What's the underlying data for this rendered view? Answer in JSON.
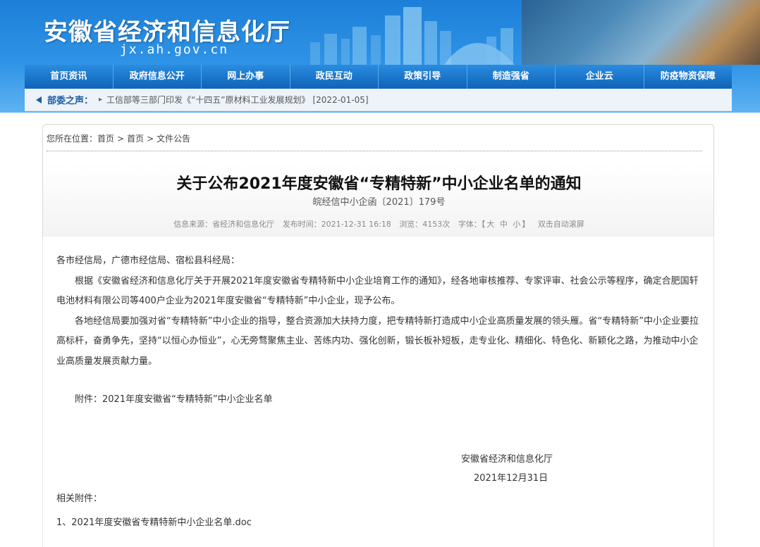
{
  "site": {
    "title": "安徽省经济和信息化厅",
    "domain": "jx.ah.gov.cn"
  },
  "nav": {
    "items": [
      "首页资讯",
      "政府信息公开",
      "网上办事",
      "政民互动",
      "政策引导",
      "制造强省",
      "企业云",
      "防疫物资保障"
    ]
  },
  "announce": {
    "label": "部委之声：",
    "link_text": "工信部等三部门印发《“十四五”原材料工业发展规划》",
    "date": "[2022-01-05]"
  },
  "breadcrumb": {
    "prefix": "您所在位置：",
    "items": [
      "首页",
      "首页",
      "文件公告"
    ],
    "separator": ">"
  },
  "article": {
    "title": "关于公布2021年度安徽省“专精特新”中小企业名单的通知",
    "doc_number": "皖经信中小企函〔2021〕179号",
    "meta": {
      "source": "信息来源：省经济和信息化厅",
      "published": "发布时间：2021-12-31 16:18",
      "views": "浏览：4153次",
      "font_label": "字体：【",
      "font_large": "大",
      "font_medium": "中",
      "font_small": "小",
      "font_close": "】",
      "autoscroll": "双击自动滚屏"
    },
    "salutation": "各市经信局，广德市经信局、宿松县科经局：",
    "paragraphs": [
      "根据《安徽省经济和信息化厅关于开展2021年度安徽省专精特新中小企业培育工作的通知》，经各地审核推荐、专家评审、社会公示等程序，确定合肥国轩电池材料有限公司等400户企业为2021年度安徽省“专精特新”中小企业，现予公布。",
      "各地经信局要加强对省“专精特新”中小企业的指导，整合资源加大扶持力度，把专精特新打造成中小企业高质量发展的领头雁。省“专精特新”中小企业要拉高标杆，奋勇争先，坚持“以恒心办恒业”，心无旁骛聚焦主业、苦练内功、强化创新，锻长板补短板，走专业化、精细化、特色化、新颖化之路，为推动中小企业高质量发展贡献力量。"
    ],
    "attachment": "附件：2021年度安徽省“专精特新”中小企业名单",
    "signature_org": "安徽省经济和信息化厅",
    "signature_date": "2021年12月31日",
    "related_label": "相关附件：",
    "related_files": [
      "1、2021年度安徽省专精特新中小企业名单.doc"
    ]
  },
  "colors": {
    "header_blue": "#1d7fd8",
    "nav_blue": "#0f63b8",
    "announce_label": "#1b5da8"
  }
}
